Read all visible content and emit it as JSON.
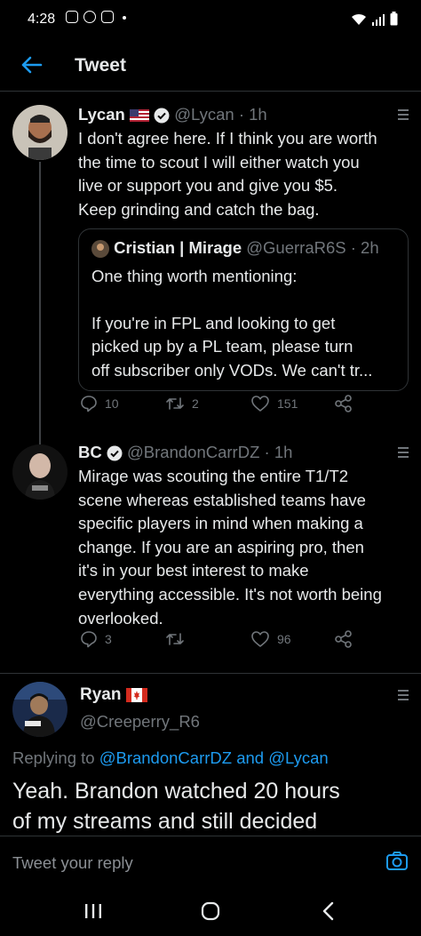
{
  "status": {
    "time": "4:28"
  },
  "header": {
    "title": "Tweet"
  },
  "tweets": [
    {
      "name": "Lycan",
      "handle": "@Lycan",
      "time": "· 1h",
      "text": [
        "I don't agree here. If I think you are worth",
        "the time to scout I will either watch you",
        "live or support you and give you $5.",
        "Keep grinding and catch the bag."
      ],
      "quote": {
        "name": "Cristian | Mirage",
        "handle": "@GuerraR6S",
        "time": "· 2h",
        "line1": "One thing worth mentioning:",
        "text": [
          "If you're in FPL and looking to get",
          "picked up by a PL team, please turn",
          "off subscriber only VODs. We can't tr..."
        ]
      },
      "replies": "10",
      "retweets": "2",
      "likes": "151"
    },
    {
      "name": "BC",
      "handle": "@BrandonCarrDZ",
      "time": "· 1h",
      "text": [
        "Mirage was scouting the entire T1/T2",
        "scene whereas established teams have",
        "specific players in mind when making a",
        "change. If you are an aspiring pro, then",
        "it's in your best interest to make",
        "everything accessible. It's not worth being",
        "overlooked."
      ],
      "replies": "3",
      "retweets": "",
      "likes": "96"
    }
  ],
  "main_tweet": {
    "name": "Ryan",
    "handle": "@Creeperry_R6",
    "replying_prefix": "Replying to",
    "replying_to_1": "@BrandonCarrDZ",
    "replying_and": "and",
    "replying_to_2": "@Lycan",
    "text": [
      "Yeah. Brandon watched 20 hours",
      "of my streams and still decided"
    ]
  },
  "reply": {
    "placeholder": "Tweet your reply"
  },
  "colors": {
    "background": "#000000",
    "text": "#e7e9ea",
    "muted": "#71767b",
    "accent": "#1d9bf0",
    "border": "#2f3336"
  },
  "icons": [
    "back-arrow-icon",
    "verified-icon",
    "more-icon",
    "reply-icon",
    "retweet-icon",
    "like-icon",
    "share-icon",
    "camera-icon",
    "recent-apps-icon",
    "home-icon",
    "nav-back-icon",
    "us-flag-icon",
    "canada-flag-icon"
  ]
}
